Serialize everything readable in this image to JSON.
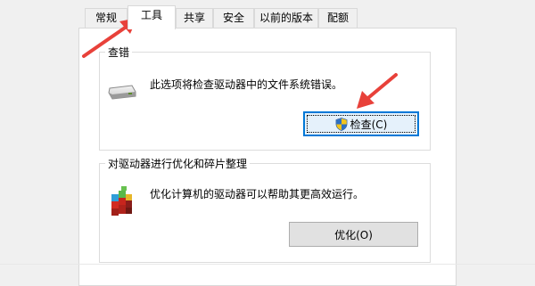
{
  "tabs": [
    {
      "label": "常规"
    },
    {
      "label": "工具",
      "active": true
    },
    {
      "label": "共享"
    },
    {
      "label": "安全"
    },
    {
      "label": "以前的版本"
    },
    {
      "label": "配额"
    }
  ],
  "error_check": {
    "title": "查错",
    "description": "此选项将检查驱动器中的文件系统错误。",
    "button_label": "检查(C)",
    "icon": "drive-icon",
    "button_icon": "uac-shield-icon"
  },
  "optimize": {
    "title": "对驱动器进行优化和碎片整理",
    "description": "优化计算机的驱动器可以帮助其更高效运行。",
    "button_label": "优化(O)",
    "icon": "defrag-icon"
  },
  "colors": {
    "annotation_arrow": "#e8413a",
    "focus_border": "#0078d7"
  }
}
